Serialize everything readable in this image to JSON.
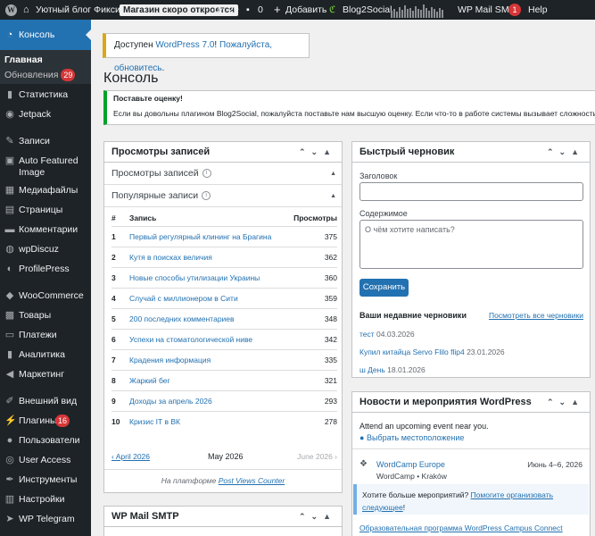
{
  "adminbar": {
    "site_name": "Уютный блог Фиксина",
    "store_badge": "Магазин скоро откроется",
    "updates_count": "29",
    "comments_count": "0",
    "add_new": "Добавить",
    "blog2social": "Blog2Social",
    "wp_mail_smtp": "WP Mail SMTP",
    "smtp_badge": "1",
    "help": "Help"
  },
  "sidebar": {
    "console": "Консоль",
    "home": "Главная",
    "updates": "Обновления",
    "updates_badge": "29",
    "items": [
      {
        "label": "Статистика",
        "icon": "bar-chart-icon"
      },
      {
        "label": "Jetpack",
        "icon": "jetpack-icon"
      },
      {
        "label": "Записи",
        "icon": "pin-icon"
      },
      {
        "label": "Auto Featured Image",
        "icon": "image-icon"
      },
      {
        "label": "Медиафайлы",
        "icon": "media-icon"
      },
      {
        "label": "Страницы",
        "icon": "page-icon"
      },
      {
        "label": "Комментарии",
        "icon": "comment-icon"
      },
      {
        "label": "wpDiscuz",
        "icon": "discuz-icon"
      },
      {
        "label": "ProfilePress",
        "icon": "profile-icon"
      },
      {
        "label": "WooCommerce",
        "icon": "woo-icon"
      },
      {
        "label": "Товары",
        "icon": "products-icon"
      },
      {
        "label": "Платежи",
        "icon": "payments-icon"
      },
      {
        "label": "Аналитика",
        "icon": "analytics-icon"
      },
      {
        "label": "Маркетинг",
        "icon": "megaphone-icon"
      },
      {
        "label": "Внешний вид",
        "icon": "brush-icon"
      },
      {
        "label": "Плагины",
        "icon": "plugin-icon"
      },
      {
        "label": "Пользователи",
        "icon": "users-icon"
      },
      {
        "label": "User Access",
        "icon": "user-access-icon"
      },
      {
        "label": "Инструменты",
        "icon": "wrench-icon"
      },
      {
        "label": "Настройки",
        "icon": "settings-icon"
      },
      {
        "label": "WP Telegram",
        "icon": "telegram-icon"
      }
    ],
    "plugins_badge": "16"
  },
  "update_notice": {
    "prefix": "Доступен ",
    "link1": "WordPress 7.0",
    "middle": "! ",
    "link2": "Пожалуйста, обновитесь",
    "suffix": "."
  },
  "page_title": "Консоль",
  "rate_notice": {
    "title": "Поставьте оценку!",
    "text": "Если вы довольны плагином Blog2Social, пожалуйста поставьте нам высшую оценку. Если что-то в работе системы вызывает сложности, п"
  },
  "views_box": {
    "title": "Просмотры записей",
    "sub1": "Просмотры записей",
    "sub2": "Популярные записи",
    "col_num": "#",
    "col_post": "Запись",
    "col_views": "Просмотры",
    "rows": [
      {
        "n": "1",
        "title": "Первый регулярный клининг на Брагина",
        "views": "375"
      },
      {
        "n": "2",
        "title": "Кутя в поисках величия",
        "views": "362"
      },
      {
        "n": "3",
        "title": "Новые способы утилизации Украины",
        "views": "360"
      },
      {
        "n": "4",
        "title": "Случай с миллионером в Сити",
        "views": "359"
      },
      {
        "n": "5",
        "title": "200 последних комментариев",
        "views": "348"
      },
      {
        "n": "6",
        "title": "Успехи на стоматологической ниве",
        "views": "342"
      },
      {
        "n": "7",
        "title": "Крадения информация",
        "views": "335"
      },
      {
        "n": "8",
        "title": "Жаркий бег",
        "views": "321"
      },
      {
        "n": "9",
        "title": "Доходы за апрель 2026",
        "views": "293"
      },
      {
        "n": "10",
        "title": "Кризис IT в ВК",
        "views": "278"
      }
    ],
    "prev": "‹ April 2026",
    "current": "May 2026",
    "next": "June 2026 ›",
    "footer_prefix": "На платформе ",
    "footer_link": "Post Views Counter"
  },
  "smtp_box": {
    "title": "WP Mail SMTP"
  },
  "draft_box": {
    "title": "Быстрый черновик",
    "title_label": "Заголовок",
    "content_label": "Содержимое",
    "content_placeholder": "О чём хотите написать?",
    "save": "Сохранить",
    "recent": "Ваши недавние черновики",
    "view_all": "Посмотреть все черновики",
    "drafts": [
      {
        "title": "тест",
        "date": "04.03.2026"
      },
      {
        "title": "Купил китайца Servo Flilo flip4",
        "date": "23.01.2026"
      },
      {
        "title": "ш День",
        "date": "18.01.2026"
      }
    ]
  },
  "news_box": {
    "title": "Новости и мероприятия WordPress",
    "attend": "Attend an upcoming event near you.",
    "location": "Выбрать местоположение",
    "event_title": "WordCamp Europe",
    "event_place": "WordCamp • Kraków",
    "event_date": "Июнь 4–6, 2026",
    "more_prefix": "Хотите больше мероприятий? ",
    "more_link": "Помогите организовать следующее",
    "more_suffix": "!",
    "program": "Образовательная программа WordPress Campus Connect"
  }
}
